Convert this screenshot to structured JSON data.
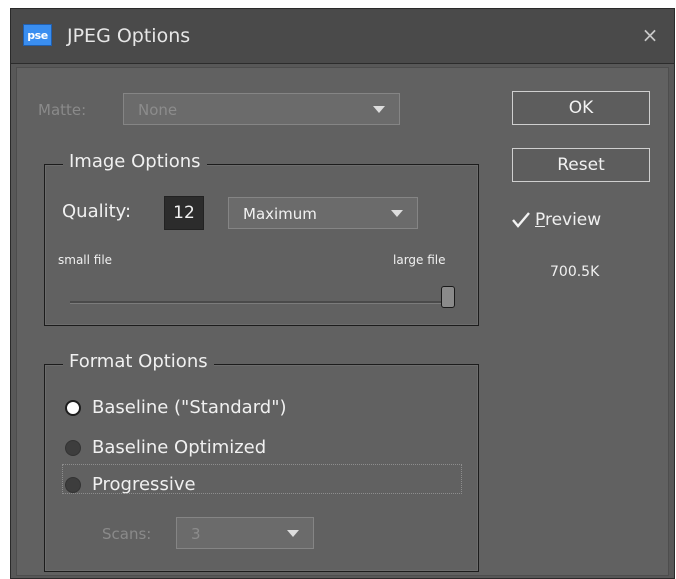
{
  "window": {
    "title": "JPEG Options",
    "app_icon_text": "pse",
    "close_glyph": "×"
  },
  "matte": {
    "label": "Matte:",
    "value": "None"
  },
  "buttons": {
    "ok": "OK",
    "reset": "Reset"
  },
  "preview": {
    "label_prefix": "P",
    "label_rest": "review",
    "checked": true,
    "file_size": "700.5K"
  },
  "image_options": {
    "legend": "Image Options",
    "quality_label": "Quality:",
    "quality_value": "12",
    "quality_preset": "Maximum",
    "small_file_label": "small file",
    "large_file_label": "large file",
    "slider_fraction": 1.0
  },
  "format_options": {
    "legend": "Format Options",
    "options": [
      {
        "label": "Baseline (\"Standard\")",
        "selected": true
      },
      {
        "label": "Baseline Optimized",
        "selected": false
      },
      {
        "label": "Progressive",
        "selected": false
      }
    ],
    "scans_label": "Scans:",
    "scans_value": "3"
  },
  "colors": {
    "dialog_bg": "#616161",
    "titlebar_bg": "#4a4a4a",
    "app_icon": "#3a8ef0"
  },
  "icons": {
    "app": "photoshop-elements-icon",
    "close": "close-icon",
    "check": "checkmark-icon",
    "dropdown": "chevron-down-icon"
  }
}
